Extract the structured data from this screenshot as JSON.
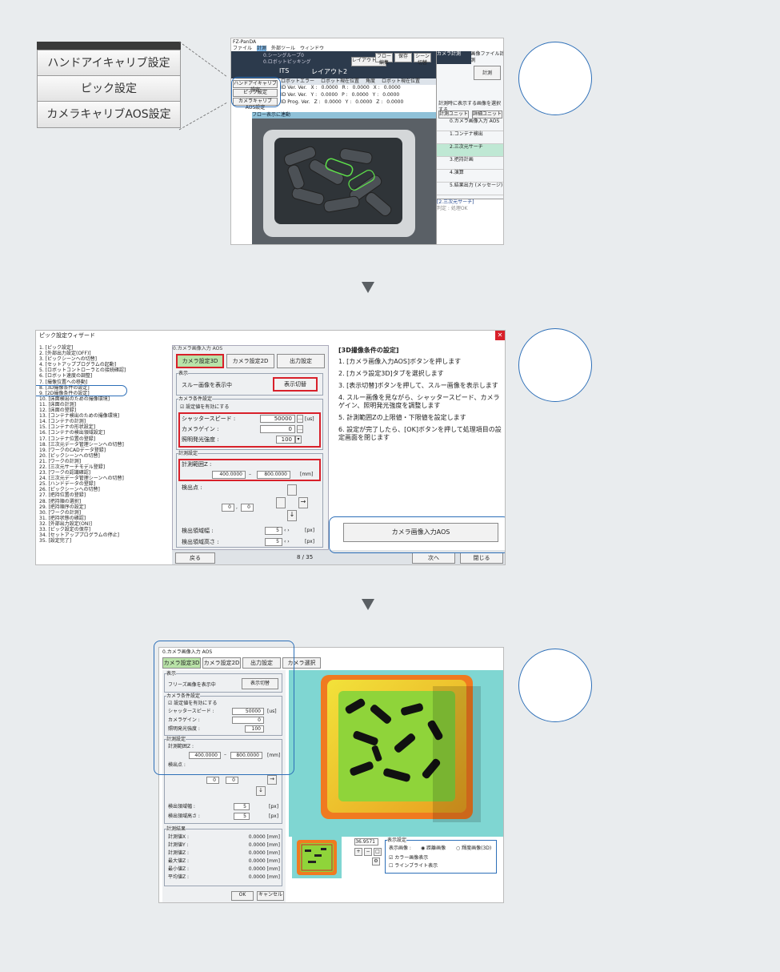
{
  "section1": {
    "zoom_menu": [
      "ハンドアイキャリブ設定",
      "ピック設定",
      "カメラキャリブAOS設定"
    ],
    "app": {
      "title": "FZ-PanDA",
      "menu": [
        "ファイル",
        "計測",
        "外部ツール",
        "ウィンドウ"
      ],
      "scene_info": [
        "0.シーングループ0",
        "0.ロボットピッキング"
      ],
      "buttons_top": [
        "フロー編集",
        "保存",
        "シーン切替",
        "シーン切替"
      ],
      "mode_label": "ITS",
      "layout_label": "レイアウト2",
      "layout_switch": "レイアウト切替",
      "side_buttons": [
        "ハンドアイキャリブ設定",
        "ピック設定",
        "カメラキャリブAOS設定"
      ],
      "robot_header": [
        "ロボットエラー",
        "ロボット現在位置",
        "角度",
        "ロボット現在位置"
      ],
      "robot_rows": [
        [
          "ID Ver. Ver.",
          "X :",
          "0.0000",
          "R :",
          "0.0000",
          "X :",
          "0.0000",
          "R :",
          "0.0000"
        ],
        [
          "ID Ver. Ver.",
          "Y :",
          "0.0000",
          "P :",
          "0.0000",
          "Y :",
          "0.0000",
          "P :",
          "0.0000"
        ],
        [
          "ID Prog. Ver.",
          "Z :",
          "0.0000",
          "Y :",
          "0.0000",
          "Z :",
          "0.0000",
          "Y :",
          "0.0000"
        ]
      ],
      "image_label": "フロー表示に連動",
      "right_tabs": [
        "カメラ計測",
        "画像ファイル計測"
      ],
      "run_button": "計測",
      "right_note": "計測時に表示する画像を選択する",
      "flow_tabs": [
        "計測ユニット",
        "詳細ユニット"
      ],
      "flow_items": [
        "0.カメラ画像入力 AOS",
        "1.コンテナ検出",
        "2.三次元サーチ",
        "3.把持計画",
        "4.演算",
        "5.結果出力 (メッセージ)"
      ],
      "detail_title": "[2.三次元サーチ]",
      "detail_text": "判定 : 処理OK"
    }
  },
  "section2": {
    "title": "ピック設定ウィザード",
    "steps": [
      "1. [ピック設定]",
      "2. [外部出力設定(OFF)]",
      "3. [ピックシーンへの切替]",
      "4. [セットアッププログラムの起動]",
      "5. [ロボットコントローラとの接続確認]",
      "6. [ロボット速度の調整]",
      "7. [撮像位置への移動]",
      "8. [3D撮像条件の設定]",
      "9. [2D撮像条件の設定]",
      "10. [床面検出のための撮像環境]",
      "11. [床面の計測]",
      "12. [床面の登録]",
      "13. [コンテナ検出のための撮像環境]",
      "14. [コンテナの計測]",
      "15. [コンテナの形状設定]",
      "16. [コンテナの検出領域設定]",
      "17. [コンテナ位置の登録]",
      "18. [三次元データ管理シーンへの切替]",
      "19. [ワークのCADデータ登録]",
      "20. [ピックシーンへの切替]",
      "21. [ワークの計測]",
      "22. [三次元サーチモデル登録]",
      "23. [ワークの認識確認]",
      "24. [三次元データ管理シーンへの切替]",
      "25. [ハンドデータの登録]",
      "26. [ピックシーンへの切替]",
      "27. [把持位置の登録]",
      "28. [把持順の選択]",
      "29. [把持順序の設定]",
      "30. [ワークの計測]",
      "31. [把持状態の確認]",
      "32. [外部出力設定(ON)]",
      "33. [ピック設定の保存]",
      "34. [セットアッププログラムの停止]",
      "35. [設定完了]"
    ],
    "panel_caption": "0.カメラ画像入力 AOS",
    "tabs": [
      "カメラ設定3D",
      "カメラ設定2D",
      "出力設定"
    ],
    "display_group": "表示",
    "display_text": "スルー画像を表示中",
    "display_button": "表示切替",
    "camera_group": "カメラ条件設定",
    "camera_check": "☑ 設定値を有効にする",
    "shutter_label": "シャッタースピード :",
    "shutter_value": "50000",
    "shutter_unit": "[us]",
    "gain_label": "カメラゲイン :",
    "gain_value": "0",
    "light_label": "照明発光強度 :",
    "light_value": "100",
    "measure_group": "計測設定",
    "range_label": "計測範囲Z :",
    "range_min": "400.0000",
    "range_max": "800.0000",
    "range_unit": "[mm]",
    "detect_label": "検出点 :",
    "detect_x": "0",
    "detect_y": "0",
    "width_label": "検出領域幅 :",
    "width_value": "5",
    "height_label": "検出領域高さ :",
    "height_value": "5",
    "px_unit": "[px]",
    "back_button": "戻る",
    "page_counter": "8 / 35",
    "next_button": "次へ",
    "close_button": "閉じる",
    "help_title": "[3D撮像条件の設定]",
    "help_lines": [
      "1. [カメラ画像入力AOS]ボタンを押します",
      "2. [カメラ設定3D]タブを選択します",
      "3. [表示切替]ボタンを押して、スルー画像を表示します",
      "4. スルー画像を見ながら、シャッタースピード、カメラゲイン、照明発光強度を調整します",
      "5. 計測範囲Zの上限値・下限値を設定します",
      "6. 設定が完了したら、[OK]ボタンを押して処理項目の設定画面を閉じます"
    ],
    "aos_button": "カメラ画像入力AOS"
  },
  "section3": {
    "caption": "0.カメラ画像入力 AOS",
    "tabs": [
      "カメラ設定3D",
      "カメラ設定2D",
      "出力設定",
      "カメラ選択"
    ],
    "display_group": "表示",
    "display_text": "フリーズ画像を表示中",
    "display_button": "表示切替",
    "camera_group": "カメラ条件設定",
    "camera_check": "☑ 設定値を有効にする",
    "shutter_label": "シャッタースピード :",
    "shutter_value": "50000",
    "shutter_unit": "[us]",
    "gain_label": "カメラゲイン :",
    "gain_value": "0",
    "light_label": "照明発光強度 :",
    "light_value": "100",
    "measure_group": "計測設定",
    "range_label": "計測範囲Z :",
    "range_min": "400.0000",
    "range_max": "800.0000",
    "range_unit": "[mm]",
    "detect_label": "検出点 :",
    "detect_x": "0",
    "detect_y": "0",
    "width_label": "検出領域幅 :",
    "width_value": "5",
    "height_label": "検出領域高さ :",
    "height_value": "5",
    "px_unit": "[px]",
    "result_group": "計測結果",
    "results": [
      {
        "label": "計測値X :",
        "value": "0.0000 [mm]"
      },
      {
        "label": "計測値Y :",
        "value": "0.0000 [mm]"
      },
      {
        "label": "計測値Z :",
        "value": "0.0000 [mm]"
      },
      {
        "label": "最大値Z :",
        "value": "0.0000 [mm]"
      },
      {
        "label": "最小値Z :",
        "value": "0.0000 [mm]"
      },
      {
        "label": "平均値Z :",
        "value": "0.0000 [mm]"
      }
    ],
    "zoom_value": "36.9571",
    "view_group": "表示設定",
    "view_label": "表示画像 :",
    "view_opt1": "◉ 距離画像",
    "view_opt2": "○ 輝度画像(3D)",
    "color_check": "☑ カラー画像表示",
    "line_check": "☐ ラインブライト表示",
    "ok_button": "OK",
    "cancel_button": "キャンセル"
  },
  "colors": {
    "accent_blue": "#2d6fb8",
    "highlight_red": "#d8202a",
    "tab_green": "#b9e3a8",
    "flow_highlight": "#bfe8d4"
  }
}
